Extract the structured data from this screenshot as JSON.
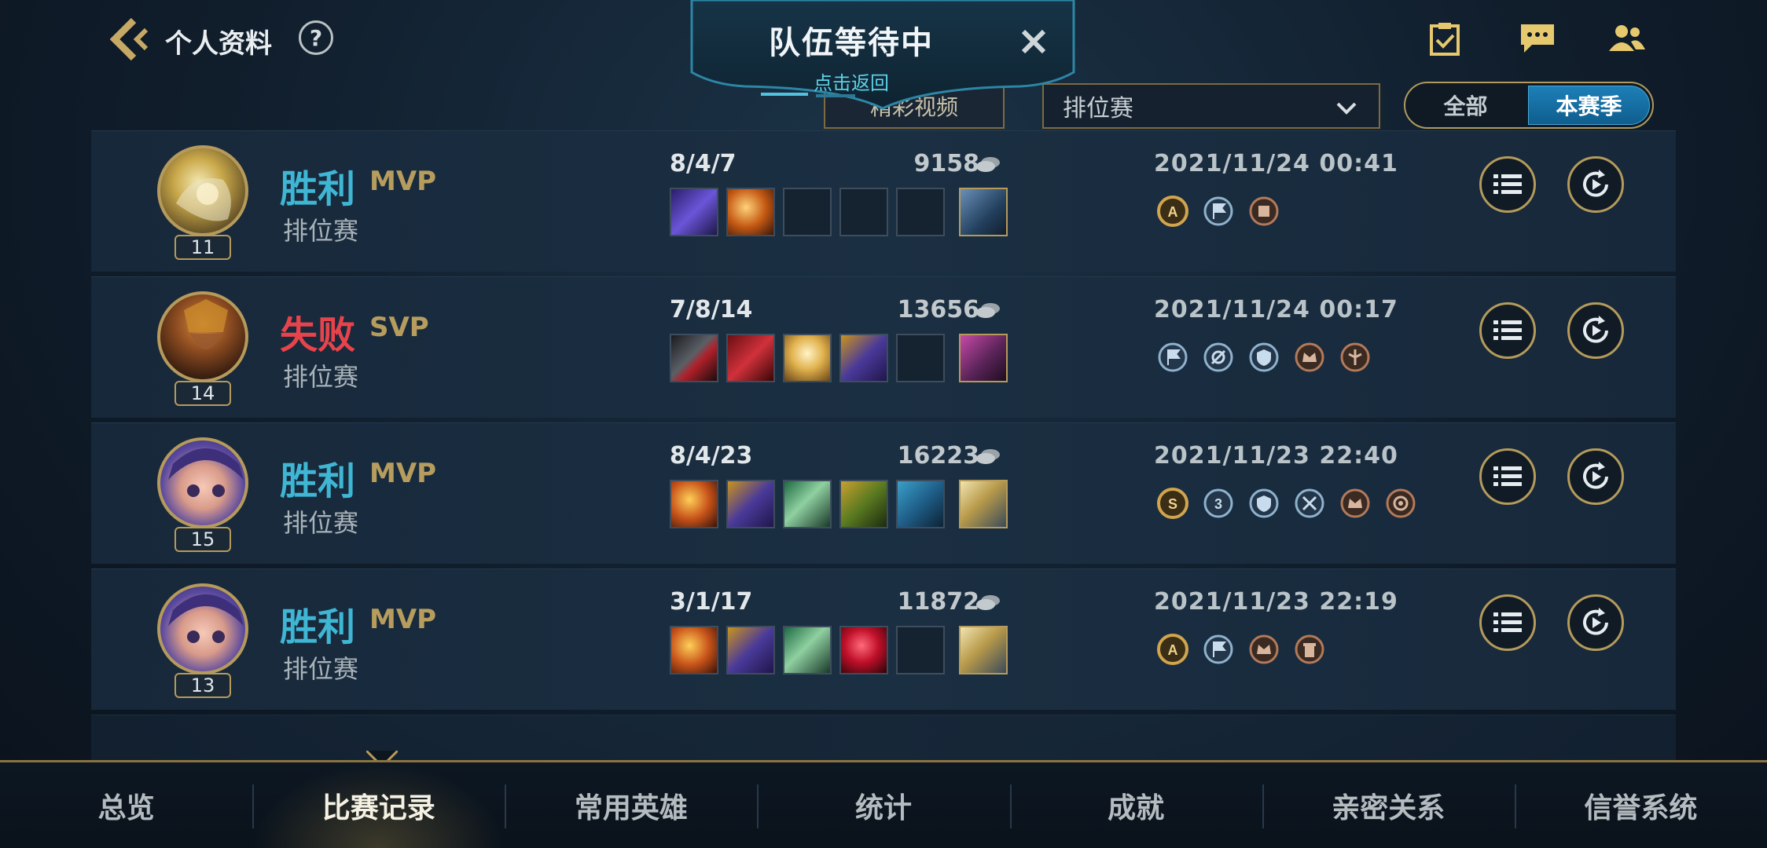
{
  "header": {
    "title": "个人资料",
    "help_label": "?",
    "icons": [
      "task-icon",
      "chat-icon",
      "friends-icon"
    ]
  },
  "queue_banner": {
    "title": "队伍等待中",
    "subtitle": "点击返回"
  },
  "filters": {
    "video_label": "精彩视频",
    "mode_value": "排位赛",
    "season_options": [
      "全部",
      "本赛季"
    ],
    "season_selected": "本赛季"
  },
  "matches": [
    {
      "result": "胜利",
      "outcome": "win",
      "grade": "MVP",
      "mode": "排位赛",
      "level": "11",
      "kda": "8/4/7",
      "gold": "9158",
      "date": "2021/11/24 00:41",
      "badges": [
        "A",
        "flag",
        "gold-medal"
      ]
    },
    {
      "result": "失败",
      "outcome": "loss",
      "grade": "SVP",
      "mode": "排位赛",
      "level": "14",
      "kda": "7/8/14",
      "gold": "13656",
      "date": "2021/11/24 00:17",
      "badges": [
        "flag",
        "ward-kill",
        "shield",
        "crown",
        "support"
      ]
    },
    {
      "result": "胜利",
      "outcome": "win",
      "grade": "MVP",
      "mode": "排位赛",
      "level": "15",
      "kda": "8/4/23",
      "gold": "16223",
      "date": "2021/11/23 22:40",
      "badges": [
        "S",
        "triple",
        "shield",
        "sword",
        "crown",
        "target"
      ]
    },
    {
      "result": "胜利",
      "outcome": "win",
      "grade": "MVP",
      "mode": "排位赛",
      "level": "13",
      "kda": "3/1/17",
      "gold": "11872",
      "date": "2021/11/23 22:19",
      "badges": [
        "A",
        "flag",
        "crown",
        "tower"
      ]
    }
  ],
  "bottom_nav": {
    "items": [
      "总览",
      "比赛记录",
      "常用英雄",
      "统计",
      "成就",
      "亲密关系",
      "信誉系统"
    ],
    "active": "比赛记录"
  },
  "colors": {
    "win": "#3fb6d4",
    "loss": "#e8434b",
    "gold_trim": "#b59a5b",
    "accent_blue": "#1d7fb7"
  }
}
